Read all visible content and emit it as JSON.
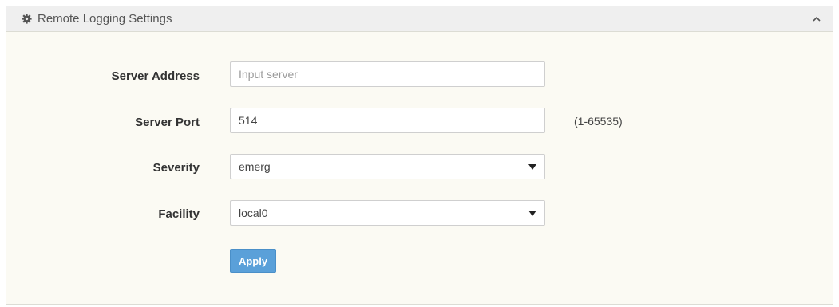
{
  "panel": {
    "title": "Remote Logging Settings",
    "header_icon": "gear-icon",
    "collapse_icon": "chevron-up-icon"
  },
  "form": {
    "server_address": {
      "label": "Server Address",
      "value": "",
      "placeholder": "Input server"
    },
    "server_port": {
      "label": "Server Port",
      "value": "514",
      "hint": "(1-65535)"
    },
    "severity": {
      "label": "Severity",
      "selected": "emerg"
    },
    "facility": {
      "label": "Facility",
      "selected": "local0"
    },
    "apply_label": "Apply"
  },
  "colors": {
    "accent": "#5aa0d9",
    "panel_background": "#fbfaf3",
    "header_background": "#efefef"
  }
}
